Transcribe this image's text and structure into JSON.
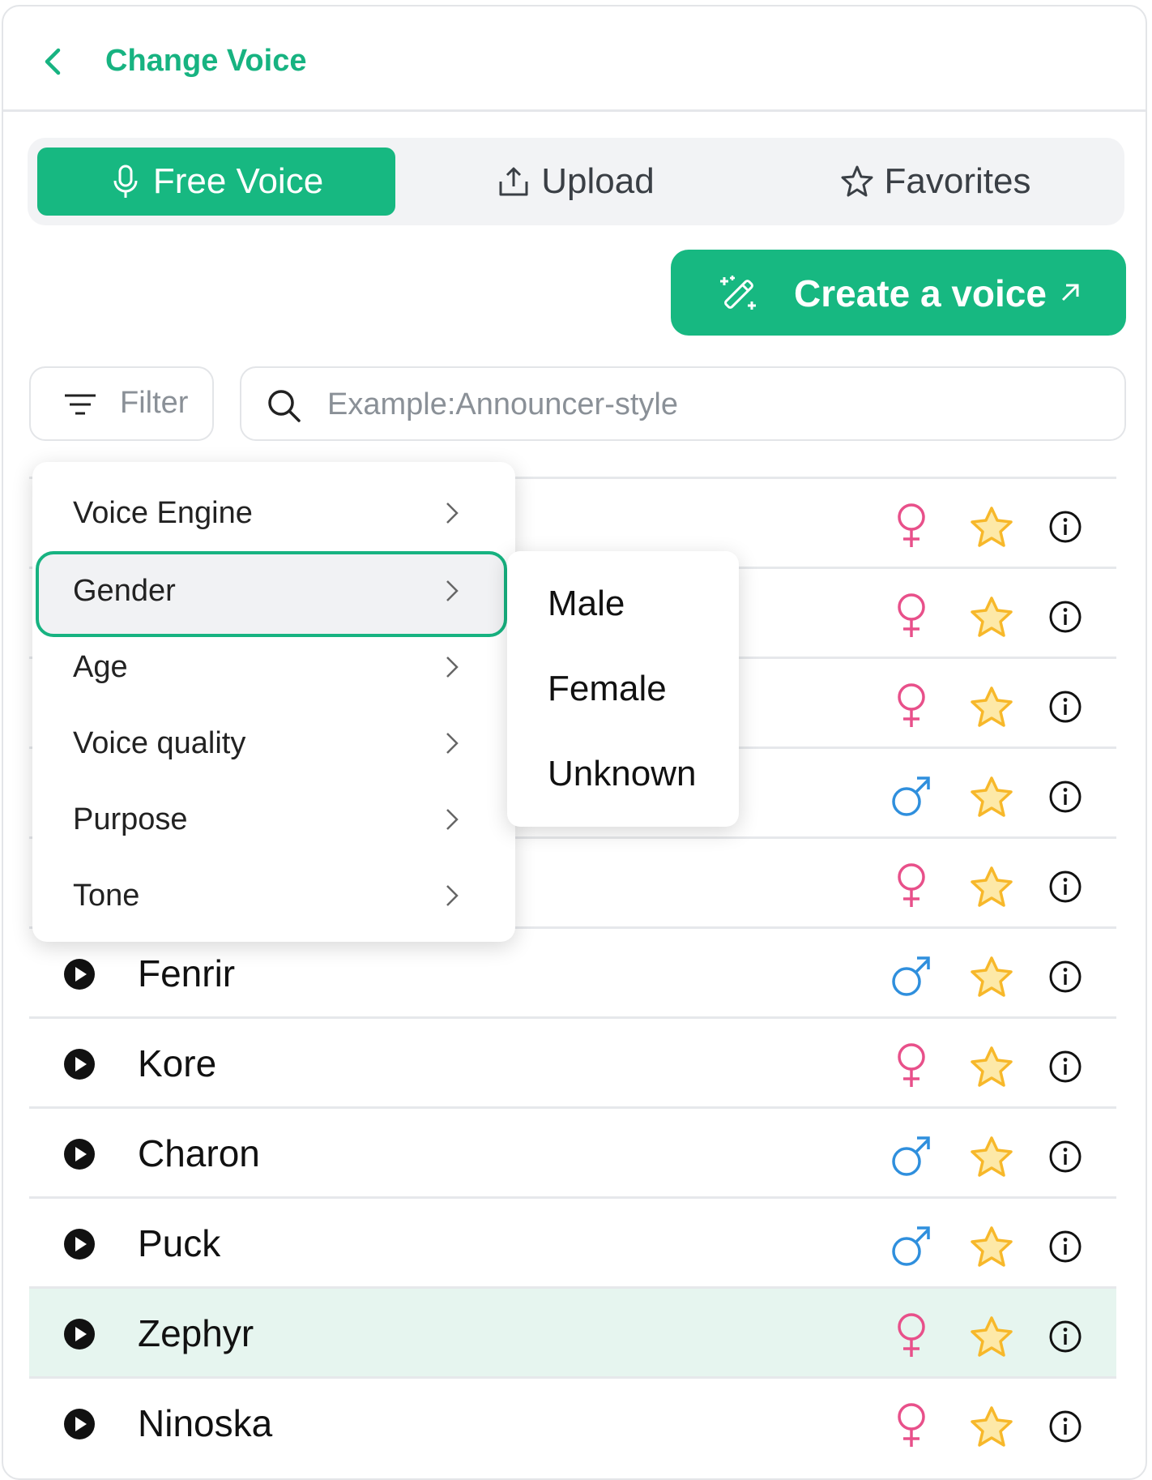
{
  "header": {
    "title": "Change Voice"
  },
  "tabs": [
    {
      "label": "Free Voice",
      "icon": "microphone-icon",
      "active": true
    },
    {
      "label": "Upload",
      "icon": "upload-icon",
      "active": false
    },
    {
      "label": "Favorites",
      "icon": "star-outline-icon",
      "active": false
    }
  ],
  "create_voice": {
    "label": "Create a voice",
    "icon": "magic-wand-icon"
  },
  "filter": {
    "label": "Filter"
  },
  "search": {
    "placeholder": "Example:Announcer-style",
    "value": ""
  },
  "filter_menu": {
    "items": [
      {
        "label": "Voice Engine"
      },
      {
        "label": "Gender",
        "highlighted": true
      },
      {
        "label": "Age"
      },
      {
        "label": "Voice quality"
      },
      {
        "label": "Purpose"
      },
      {
        "label": "Tone"
      }
    ]
  },
  "gender_submenu": {
    "options": [
      "Male",
      "Female",
      "Unknown"
    ]
  },
  "voices": [
    {
      "name": "",
      "gender": "female"
    },
    {
      "name": "",
      "gender": "female"
    },
    {
      "name": "",
      "gender": "female"
    },
    {
      "name": "",
      "gender": "male"
    },
    {
      "name": "",
      "gender": "female"
    },
    {
      "name": "Fenrir",
      "gender": "male"
    },
    {
      "name": "Kore",
      "gender": "female"
    },
    {
      "name": "Charon",
      "gender": "male"
    },
    {
      "name": "Puck",
      "gender": "male"
    },
    {
      "name": "Zephyr",
      "gender": "female",
      "selected": true
    },
    {
      "name": "Ninoska",
      "gender": "female"
    }
  ],
  "colors": {
    "accent": "#17b881",
    "female": "#e8508a",
    "male": "#2f8fdd",
    "star": "#f7b82a",
    "star_fill": "#fde9a8",
    "selected_row": "#e6f5ef"
  }
}
